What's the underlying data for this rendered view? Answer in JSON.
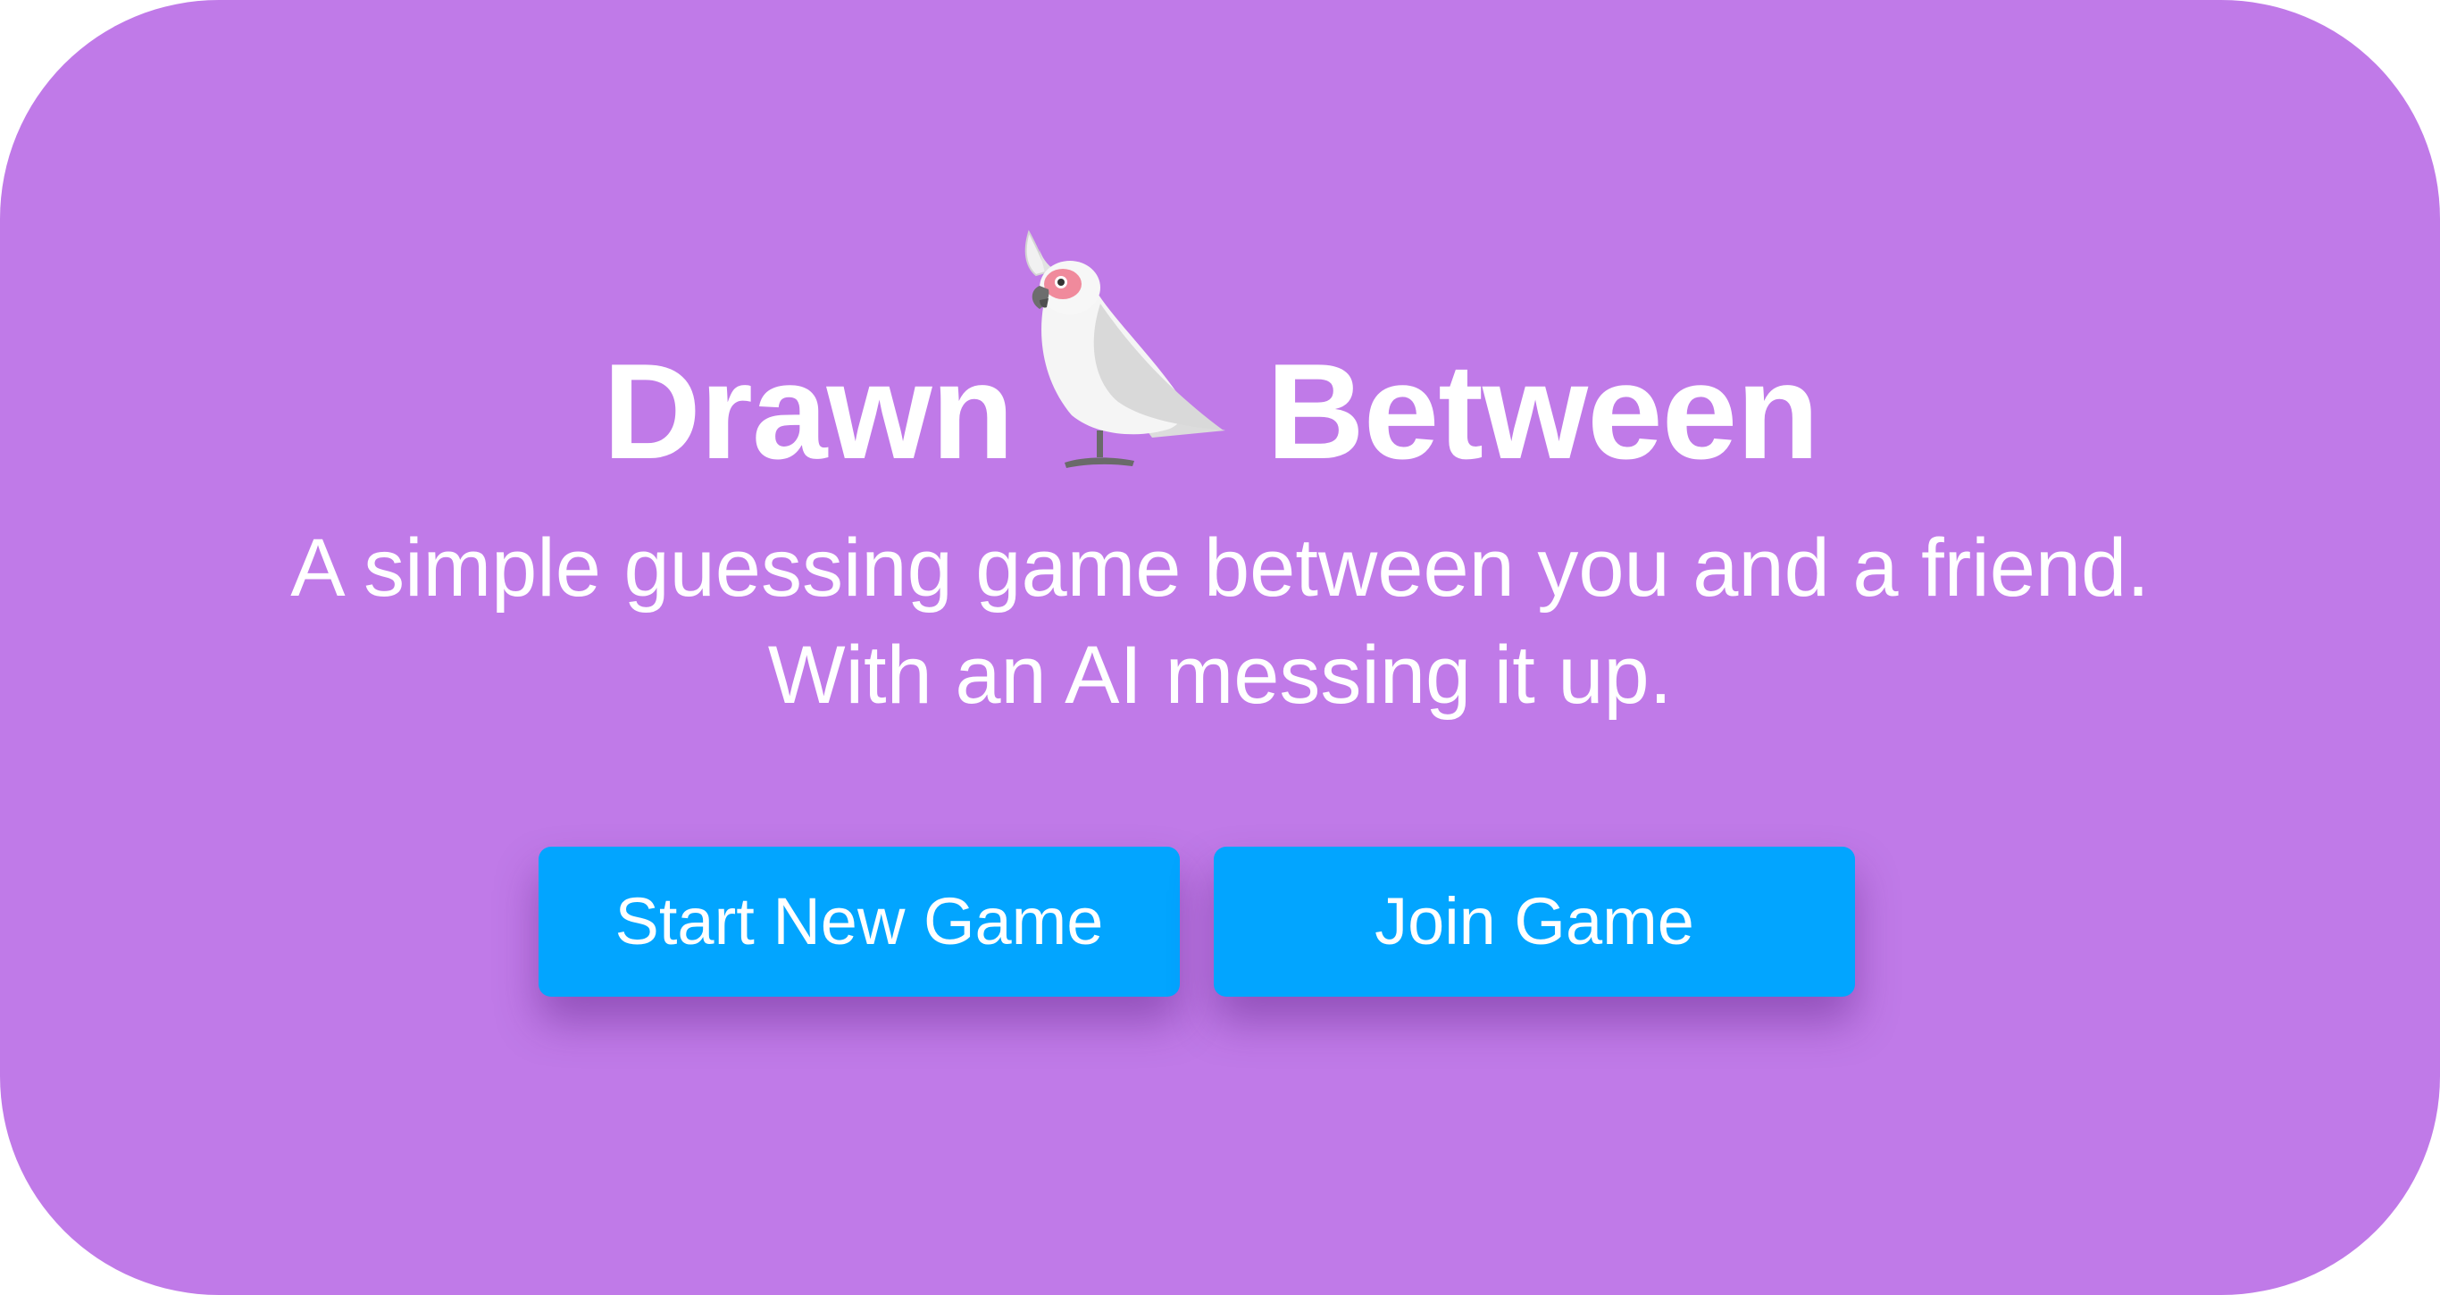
{
  "app": {
    "title_left": "Drawn",
    "title_right": "Between",
    "logo_icon": "cockatoo-icon",
    "tagline_line1": "A simple guessing game between you and a friend.",
    "tagline_line2": "With an AI messing it up."
  },
  "actions": {
    "start_label": "Start New Game",
    "join_label": "Join Game"
  },
  "colors": {
    "background": "#c07ae8",
    "button": "#02a5ff",
    "text": "#ffffff"
  }
}
